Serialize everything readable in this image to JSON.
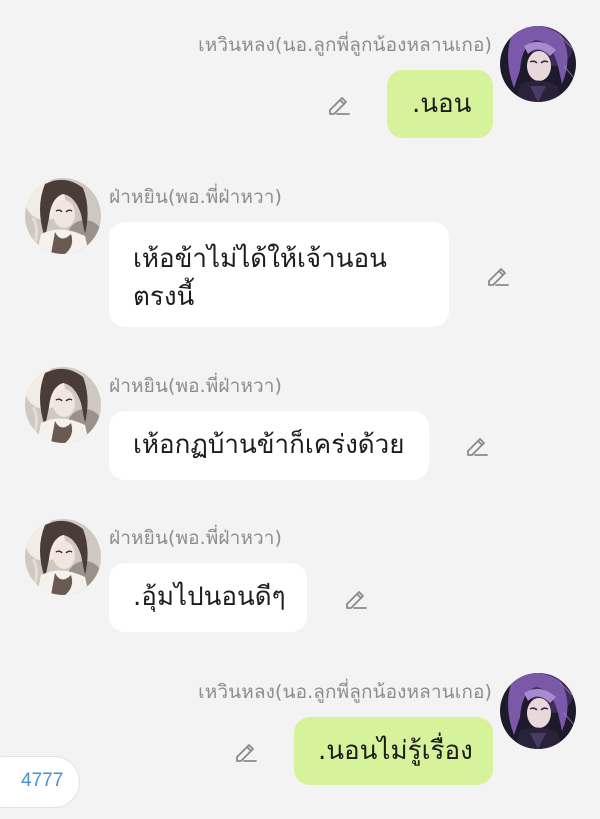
{
  "messages": [
    {
      "sender": "เหวินหลง(นอ.ลูกพี่ลูกน้องหลานเกอ)",
      "text": ".นอน",
      "side": "right"
    },
    {
      "sender": "ฝ่าหยิน(พอ.พี่ฝ่าหวา)",
      "text_line1": "เห้อข้าไม่ได้ให้เจ้านอน",
      "text_line2": "ตรงนี้",
      "side": "left"
    },
    {
      "sender": "ฝ่าหยิน(พอ.พี่ฝ่าหวา)",
      "text": "เห้อกฏบ้านข้าก็เคร่งด้วย",
      "side": "left"
    },
    {
      "sender": "ฝ่าหยิน(พอ.พี่ฝ่าหวา)",
      "text": ".อุ้มไปนอนดีๆ",
      "side": "left"
    },
    {
      "sender": "เหวินหลง(นอ.ลูกพี่ลูกน้องหลานเกอ)",
      "text": ".นอนไม่รู้เรื่อง",
      "side": "right"
    }
  ],
  "counter": {
    "value": "4777"
  },
  "colors": {
    "background": "#f3f3f3",
    "incoming_bubble": "#ffffff",
    "outgoing_bubble": "#d6f29a",
    "sender_name": "#8d8d8d",
    "counter_text": "#4a90d9"
  },
  "icons": {
    "edit": "pencil-edit-icon",
    "avatar_right": "purple-haired-character-avatar",
    "avatar_left": "dark-haired-character-avatar"
  }
}
